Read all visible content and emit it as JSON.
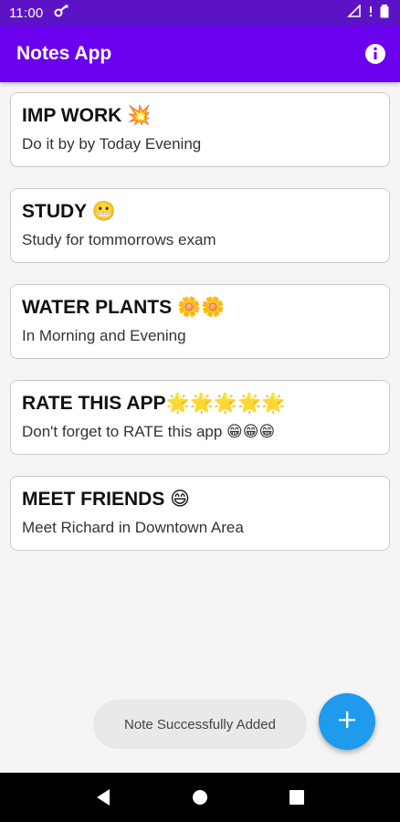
{
  "status_bar": {
    "time": "11:00",
    "icons": [
      "notification-icon",
      "wifi-icon",
      "signal-icon",
      "battery-icon"
    ]
  },
  "app_bar": {
    "title": "Notes App",
    "action_icon": "info-icon"
  },
  "notes": [
    {
      "title": "IMP WORK 💥",
      "description": "Do it by by Today Evening"
    },
    {
      "title": "STUDY 😬",
      "description": "Study for tommorrows exam"
    },
    {
      "title": "WATER PLANTS 🌼🌼",
      "description": "In Morning and Evening"
    },
    {
      "title": "RATE THIS APP🌟🌟🌟🌟🌟",
      "description": "Don't forget to RATE this app 😁😁😁"
    },
    {
      "title": "MEET FRIENDS 😄",
      "description": "Meet Richard in Downtown Area"
    }
  ],
  "toast": {
    "message": "Note Successfully Added"
  },
  "fab": {
    "icon": "add-icon"
  },
  "nav_bar": {
    "icons": [
      "back-icon",
      "home-icon",
      "recents-icon"
    ]
  },
  "colors": {
    "status_bar": "#5c13c6",
    "app_bar": "#6a00ee",
    "fab": "#1e9bec",
    "background": "#f5f5f5"
  }
}
